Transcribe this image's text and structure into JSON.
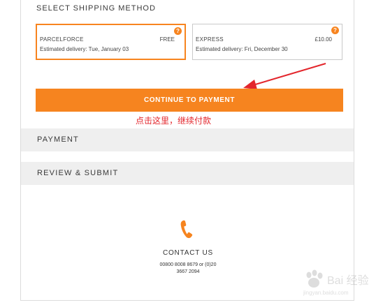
{
  "shipping": {
    "title": "SELECT SHIPPING METHOD",
    "options": [
      {
        "name": "PARCELFORCE",
        "price": "FREE",
        "eta": "Estimated delivery: Tue, January 03",
        "selected": true
      },
      {
        "name": "EXPRESS",
        "price": "£10.00",
        "eta": "Estimated delivery: Fri, December 30",
        "selected": false
      }
    ],
    "help_icon": "?"
  },
  "cta": {
    "label": "CONTINUE TO PAYMENT"
  },
  "annotation": {
    "text": "点击这里，继续付款",
    "color": "#e3262c"
  },
  "sections": {
    "payment": "PAYMENT",
    "review": "REVIEW & SUBMIT"
  },
  "contact": {
    "icon": "phone-icon",
    "title": "CONTACT US",
    "line1": "00800 8008 8679 or (0)20",
    "line2": "3667 2094"
  },
  "watermark": {
    "text": "Bai 经验",
    "url": "jingyan.baidu.com"
  },
  "colors": {
    "accent": "#f6841f",
    "panel": "#efefef",
    "annotation": "#e3262c"
  }
}
